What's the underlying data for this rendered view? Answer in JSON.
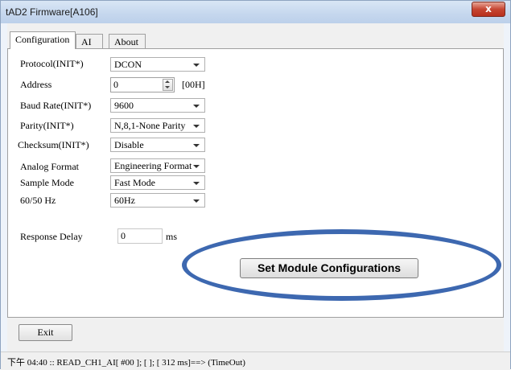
{
  "window": {
    "title": "tAD2 Firmware[A106]",
    "close_label": "x"
  },
  "tabs": [
    {
      "label": "Configuration",
      "active": true
    },
    {
      "label": "AI",
      "active": false
    },
    {
      "label": "About",
      "active": false
    }
  ],
  "config": {
    "protocol": {
      "label": "Protocol(INIT*)",
      "value": "DCON"
    },
    "address": {
      "label": "Address",
      "value": "0",
      "unit": "[00H]"
    },
    "baud_rate": {
      "label": "Baud Rate(INIT*)",
      "value": "9600"
    },
    "parity": {
      "label": "Parity(INIT*)",
      "value": "N,8,1-None Parity"
    },
    "checksum": {
      "label": "Checksum(INIT*)",
      "value": "Disable"
    },
    "analog_format": {
      "label": "Analog Format",
      "value": "Engineering Format"
    },
    "sample_mode": {
      "label": "Sample Mode",
      "value": "Fast Mode"
    },
    "freq": {
      "label": "60/50 Hz",
      "value": "60Hz"
    },
    "response_delay": {
      "label": "Response Delay",
      "value": "0",
      "unit": "ms"
    }
  },
  "buttons": {
    "set_config": "Set Module Configurations",
    "exit": "Exit"
  },
  "status": {
    "text": "下午 04:40 :: READ_CH1_AI[ #00 ]; [ ]; [ 312 ms]==> (TimeOut)"
  },
  "colors": {
    "highlight_ellipse": "#3d68b0",
    "close_button": "#c64632"
  }
}
